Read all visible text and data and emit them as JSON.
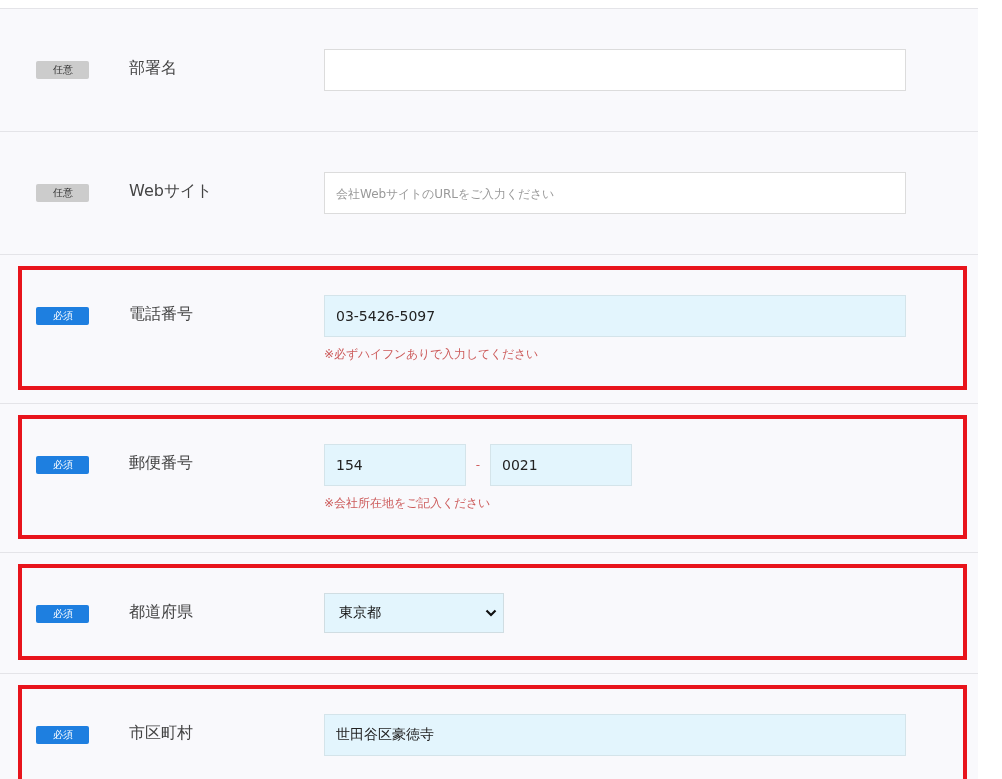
{
  "rows": [
    {
      "badge": "任意",
      "required": false,
      "label": "部署名",
      "highlighted": false,
      "kind": "text"
    },
    {
      "badge": "任意",
      "required": false,
      "label": "Webサイト",
      "highlighted": false,
      "kind": "text",
      "placeholder": "会社WebサイトのURLをご入力ください"
    },
    {
      "badge": "必須",
      "required": true,
      "label": "電話番号",
      "highlighted": true,
      "kind": "text",
      "value": "03-5426-5097",
      "note": "※必ずハイフンありで入力してください"
    },
    {
      "badge": "必須",
      "required": true,
      "label": "郵便番号",
      "highlighted": true,
      "kind": "zip",
      "values": [
        "154",
        "0021"
      ],
      "separator": "-",
      "note": "※会社所在地をご記入ください"
    },
    {
      "badge": "必須",
      "required": true,
      "label": "都道府県",
      "highlighted": true,
      "kind": "select",
      "value": "東京都"
    },
    {
      "badge": "必須",
      "required": true,
      "label": "市区町村",
      "highlighted": true,
      "kind": "text",
      "value": "世田谷区豪徳寺"
    }
  ]
}
